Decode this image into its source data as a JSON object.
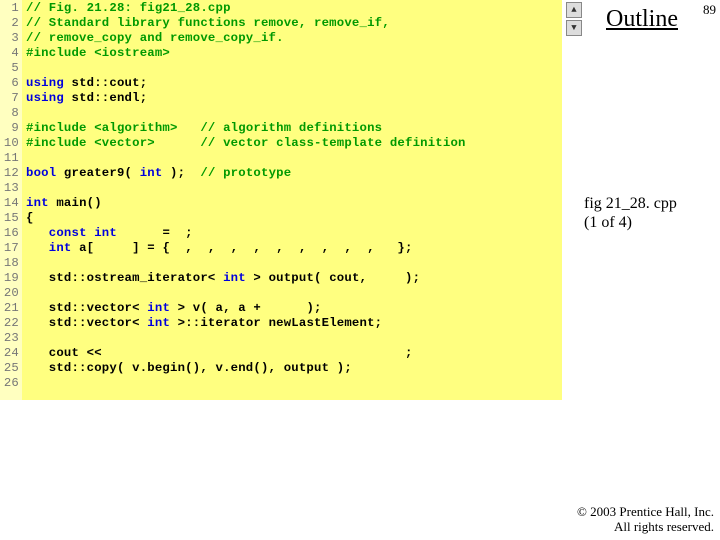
{
  "slide_number": "89",
  "outline_title": "Outline",
  "file_label": {
    "name": "fig 21_28. cpp",
    "part": "(1 of 4)"
  },
  "copyright": {
    "line1": "© 2003 Prentice Hall, Inc.",
    "line2": "All rights reserved."
  },
  "lines": [
    {
      "n": "1",
      "seg": [
        {
          "cls": "c-com",
          "t": "// Fig. 21.28: fig21_28.cpp"
        }
      ]
    },
    {
      "n": "2",
      "seg": [
        {
          "cls": "c-com",
          "t": "// Standard library functions remove, remove_if,"
        }
      ]
    },
    {
      "n": "3",
      "seg": [
        {
          "cls": "c-com",
          "t": "// remove_copy and remove_copy_if."
        }
      ]
    },
    {
      "n": "4",
      "seg": [
        {
          "cls": "c-pre",
          "t": "#include <iostream>"
        }
      ]
    },
    {
      "n": "5",
      "seg": [
        {
          "cls": "c-txt",
          "t": ""
        }
      ]
    },
    {
      "n": "6",
      "seg": [
        {
          "cls": "c-kw",
          "t": "using"
        },
        {
          "cls": "c-txt",
          "t": " std::cout;"
        }
      ]
    },
    {
      "n": "7",
      "seg": [
        {
          "cls": "c-kw",
          "t": "using"
        },
        {
          "cls": "c-txt",
          "t": " std::endl;"
        }
      ]
    },
    {
      "n": "8",
      "seg": [
        {
          "cls": "c-txt",
          "t": ""
        }
      ]
    },
    {
      "n": "9",
      "seg": [
        {
          "cls": "c-pre",
          "t": "#include <algorithm>"
        },
        {
          "cls": "c-txt",
          "t": "   "
        },
        {
          "cls": "c-com",
          "t": "// algorithm definitions"
        }
      ]
    },
    {
      "n": "10",
      "seg": [
        {
          "cls": "c-pre",
          "t": "#include <vector>"
        },
        {
          "cls": "c-txt",
          "t": "      "
        },
        {
          "cls": "c-com",
          "t": "// vector class-template definition"
        }
      ]
    },
    {
      "n": "11",
      "seg": [
        {
          "cls": "c-txt",
          "t": ""
        }
      ]
    },
    {
      "n": "12",
      "seg": [
        {
          "cls": "c-kw",
          "t": "bool"
        },
        {
          "cls": "c-txt",
          "t": " greater9( "
        },
        {
          "cls": "c-kw",
          "t": "int"
        },
        {
          "cls": "c-txt",
          "t": " );  "
        },
        {
          "cls": "c-com",
          "t": "// prototype"
        }
      ]
    },
    {
      "n": "13",
      "seg": [
        {
          "cls": "c-txt",
          "t": ""
        }
      ]
    },
    {
      "n": "14",
      "seg": [
        {
          "cls": "c-kw",
          "t": "int"
        },
        {
          "cls": "c-txt",
          "t": " main()"
        }
      ]
    },
    {
      "n": "15",
      "seg": [
        {
          "cls": "c-txt",
          "t": "{"
        }
      ]
    },
    {
      "n": "16",
      "seg": [
        {
          "cls": "c-txt",
          "t": "   "
        },
        {
          "cls": "c-kw",
          "t": "const int"
        },
        {
          "cls": "c-txt",
          "t": "      =  ;"
        }
      ]
    },
    {
      "n": "17",
      "seg": [
        {
          "cls": "c-txt",
          "t": "   "
        },
        {
          "cls": "c-kw",
          "t": "int"
        },
        {
          "cls": "c-txt",
          "t": " a[     ] = {  ,  ,  ,  ,  ,  ,  ,  ,  ,   };"
        }
      ]
    },
    {
      "n": "18",
      "seg": [
        {
          "cls": "c-txt",
          "t": ""
        }
      ]
    },
    {
      "n": "19",
      "seg": [
        {
          "cls": "c-txt",
          "t": "   std::ostream_iterator< "
        },
        {
          "cls": "c-kw",
          "t": "int"
        },
        {
          "cls": "c-txt",
          "t": " > output( cout,     );"
        }
      ]
    },
    {
      "n": "20",
      "seg": [
        {
          "cls": "c-txt",
          "t": ""
        }
      ]
    },
    {
      "n": "21",
      "seg": [
        {
          "cls": "c-txt",
          "t": "   std::vector< "
        },
        {
          "cls": "c-kw",
          "t": "int"
        },
        {
          "cls": "c-txt",
          "t": " > v( a, a +      );"
        }
      ]
    },
    {
      "n": "22",
      "seg": [
        {
          "cls": "c-txt",
          "t": "   std::vector< "
        },
        {
          "cls": "c-kw",
          "t": "int"
        },
        {
          "cls": "c-txt",
          "t": " >::iterator newLastElement;"
        }
      ]
    },
    {
      "n": "23",
      "seg": [
        {
          "cls": "c-txt",
          "t": ""
        }
      ]
    },
    {
      "n": "24",
      "seg": [
        {
          "cls": "c-txt",
          "t": "   cout <<                                        ;"
        }
      ]
    },
    {
      "n": "25",
      "seg": [
        {
          "cls": "c-txt",
          "t": "   std::copy( v.begin(), v.end(), output );"
        }
      ]
    },
    {
      "n": "26",
      "seg": [
        {
          "cls": "c-txt",
          "t": ""
        }
      ]
    }
  ]
}
